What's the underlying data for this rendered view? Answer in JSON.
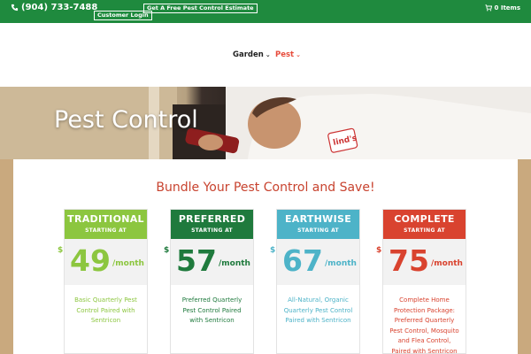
{
  "topbar": {
    "phone": "(904) 733-7488",
    "estimate_label": "Get A Free Pest Control Estimate",
    "login_label": "Customer Login",
    "cart_label": "0 Items",
    "brand_color": "#1f8a3e"
  },
  "nav": {
    "items": [
      {
        "label": "Garden",
        "icon": "chevron-down-icon"
      },
      {
        "label": "Pest",
        "icon": "chevron-down-icon"
      }
    ],
    "active_color": "#e74c3c"
  },
  "hero": {
    "title": "Pest Control"
  },
  "main": {
    "headline": "Bundle Your Pest Control and Save!",
    "plans": [
      {
        "name": "TRADITIONAL",
        "sub": "STARTING AT",
        "currency": "$",
        "price": "49",
        "per": "/month",
        "description": "Basic Quarterly Pest Control Paired with Sentricon",
        "color": "#8cc63f"
      },
      {
        "name": "PREFERRED",
        "sub": "STARTING AT",
        "currency": "$",
        "price": "57",
        "per": "/month",
        "description": "Preferred Quarterly Pest Control Paired with Sentricon",
        "color": "#1f7a3d"
      },
      {
        "name": "EARTHWISE",
        "sub": "STARTING AT",
        "currency": "$",
        "price": "67",
        "per": "/month",
        "description": "All-Natural, Organic Quarterly Pest Control Paired with Sentricon",
        "color": "#4db3c8"
      },
      {
        "name": "COMPLETE",
        "sub": "STARTING AT",
        "currency": "$",
        "price": "75",
        "per": "/month",
        "description": "Complete Home Protection Package: Preferred Quarterly Pest Control, Mosquito and Flea Control, Paired with Sentricon",
        "color": "#d9432f"
      }
    ]
  }
}
